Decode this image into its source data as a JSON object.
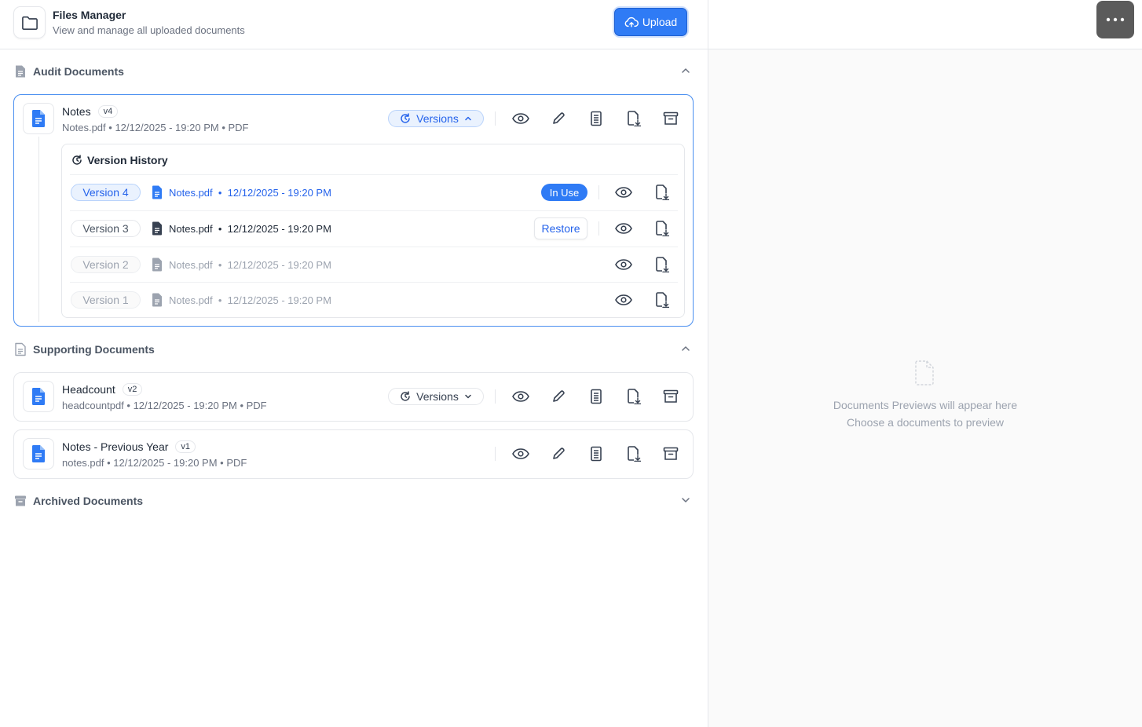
{
  "header": {
    "title": "Files Manager",
    "subtitle": "View and manage all uploaded documents",
    "upload_label": "Upload"
  },
  "sections": {
    "audit": {
      "label": "Audit Documents"
    },
    "supporting": {
      "label": "Supporting Documents"
    },
    "archived": {
      "label": "Archived Documents"
    }
  },
  "audit_doc": {
    "name": "Notes",
    "version": "v4",
    "file": "Notes.pdf",
    "date": "12/12/2025 - 19:20 PM",
    "type": "PDF",
    "versions_label": "Versions"
  },
  "version_history": {
    "title": "Version History",
    "rows": [
      {
        "label": "Version 4",
        "file": "Notes.pdf",
        "date": "12/12/2025 - 19:20 PM",
        "status": "In Use"
      },
      {
        "label": "Version 3",
        "file": "Notes.pdf",
        "date": "12/12/2025 - 19:20 PM",
        "action": "Restore"
      },
      {
        "label": "Version 2",
        "file": "Notes.pdf",
        "date": "12/12/2025 - 19:20 PM"
      },
      {
        "label": "Version 1",
        "file": "Notes.pdf",
        "date": "12/12/2025 - 19:20 PM"
      }
    ]
  },
  "supporting_docs": [
    {
      "name": "Headcount",
      "version": "v2",
      "file": "headcountpdf",
      "date": "12/12/2025 - 19:20 PM",
      "type": "PDF",
      "versions_label": "Versions"
    },
    {
      "name": "Notes - Previous Year",
      "version": "v1",
      "file": "notes.pdf",
      "date": "12/12/2025 - 19:20 PM",
      "type": "PDF"
    }
  ],
  "preview": {
    "line1": "Documents Previews will appear here",
    "line2": "Choose a documents to preview"
  },
  "colors": {
    "accent": "#2f7bf5",
    "accent_light": "#eaf2fe",
    "border": "#e5e7eb"
  }
}
